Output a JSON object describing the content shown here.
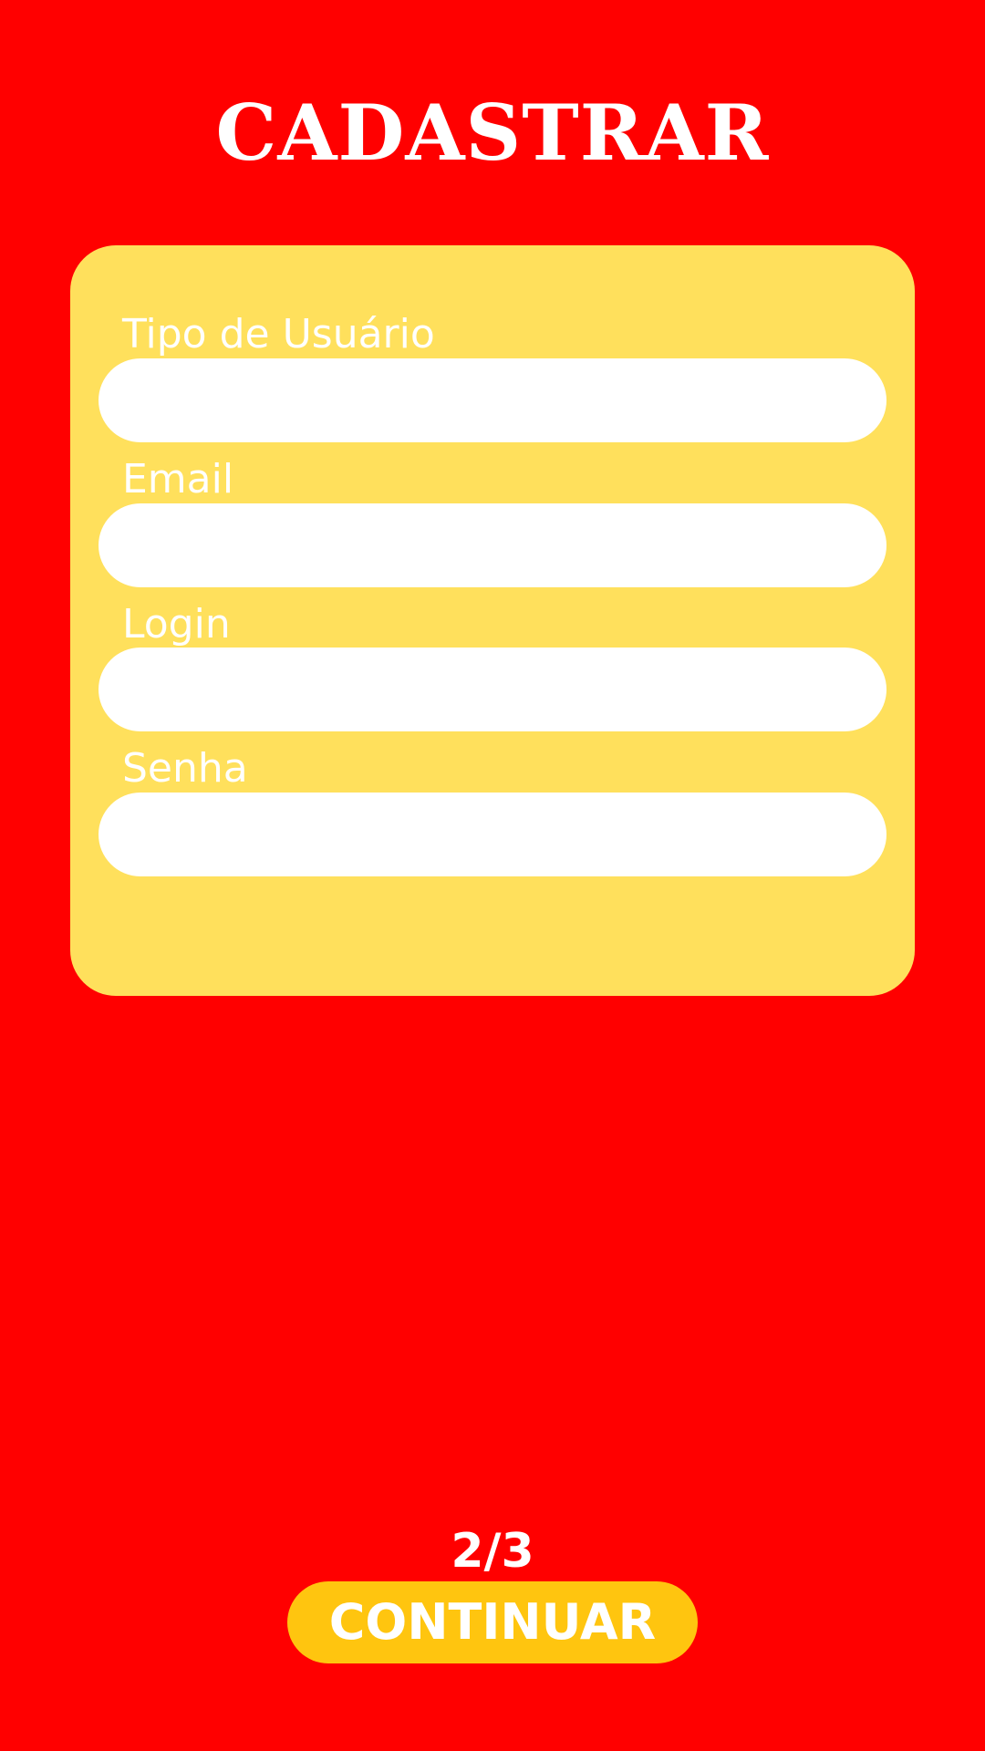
{
  "header": {
    "title": "CADASTRAR"
  },
  "form": {
    "fields": [
      {
        "label": "Tipo de Usuário",
        "value": "",
        "placeholder": ""
      },
      {
        "label": "Email",
        "value": "",
        "placeholder": ""
      },
      {
        "label": "Login",
        "value": "",
        "placeholder": ""
      },
      {
        "label": "Senha",
        "value": "",
        "placeholder": ""
      }
    ]
  },
  "footer": {
    "page_indicator": "2/3",
    "continue_label": "CONTINUAR"
  },
  "colors": {
    "background": "#ff0000",
    "card": "#ffe05c",
    "button": "#ffc50f",
    "text": "#ffffff"
  }
}
